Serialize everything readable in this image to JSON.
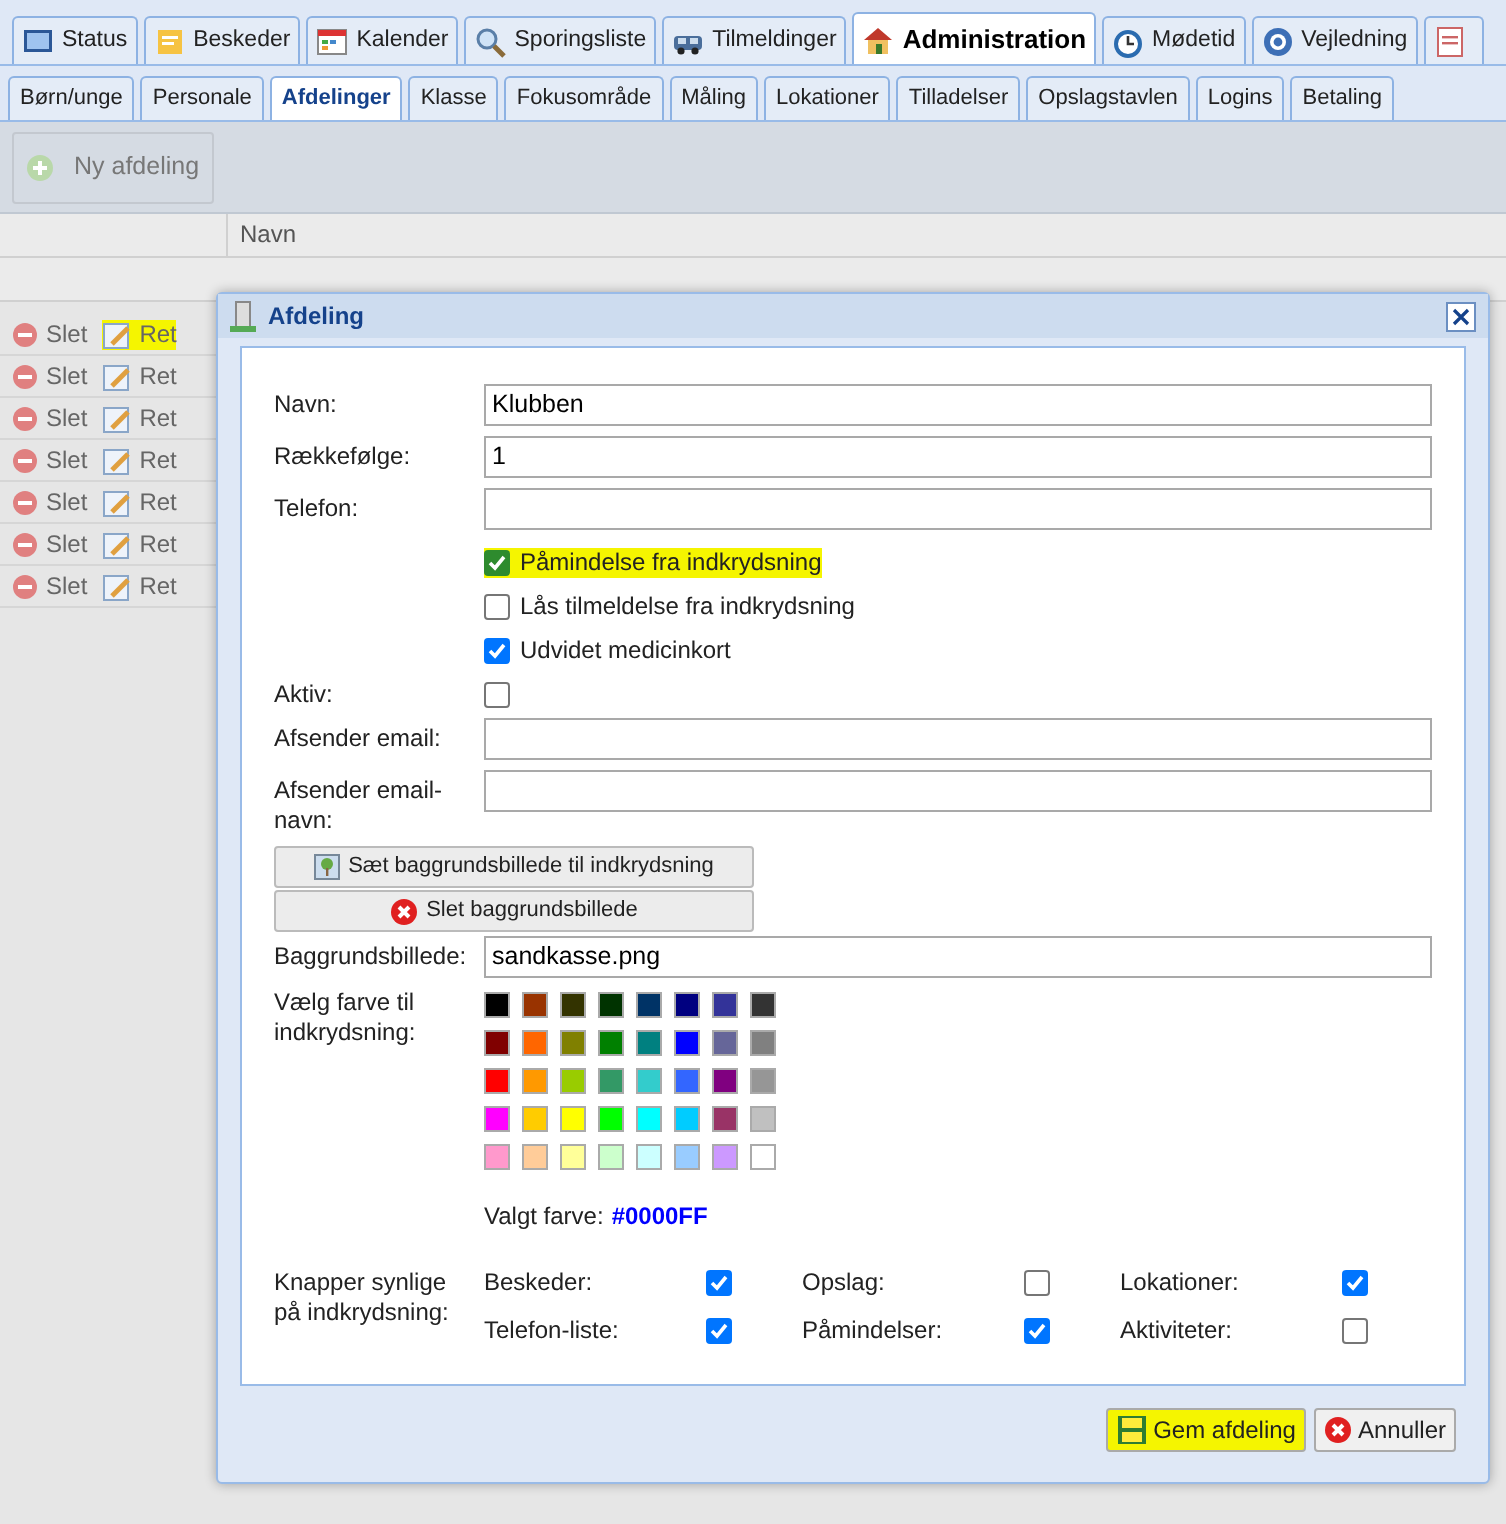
{
  "top_tabs": [
    {
      "label": "Status",
      "selected": false,
      "highlighted": false
    },
    {
      "label": "Beskeder",
      "selected": false,
      "highlighted": false
    },
    {
      "label": "Kalender",
      "selected": false,
      "highlighted": false
    },
    {
      "label": "Sporingsliste",
      "selected": false,
      "highlighted": false
    },
    {
      "label": "Tilmeldinger",
      "selected": false,
      "highlighted": false
    },
    {
      "label": "Administration",
      "selected": true,
      "highlighted": true
    },
    {
      "label": "Mødetid",
      "selected": false,
      "highlighted": false
    },
    {
      "label": "Vejledning",
      "selected": false,
      "highlighted": false
    }
  ],
  "sub_tabs": [
    {
      "label": "Børn/unge",
      "selected": false,
      "highlighted": false
    },
    {
      "label": "Personale",
      "selected": false,
      "highlighted": false
    },
    {
      "label": "Afdelinger",
      "selected": true,
      "highlighted": true
    },
    {
      "label": "Klasse",
      "selected": false,
      "highlighted": false
    },
    {
      "label": "Fokusområde",
      "selected": false,
      "highlighted": false
    },
    {
      "label": "Måling",
      "selected": false,
      "highlighted": false
    },
    {
      "label": "Lokationer",
      "selected": false,
      "highlighted": false
    },
    {
      "label": "Tilladelser",
      "selected": false,
      "highlighted": false
    },
    {
      "label": "Opslagstavlen",
      "selected": false,
      "highlighted": false
    },
    {
      "label": "Logins",
      "selected": false,
      "highlighted": false
    },
    {
      "label": "Betaling",
      "selected": false,
      "highlighted": false
    }
  ],
  "toolbar": {
    "new_button": "Ny afdeling"
  },
  "grid": {
    "column": "Navn",
    "rows": [
      {
        "delete": "Slet",
        "edit": "Ret",
        "highlighted": true
      },
      {
        "delete": "Slet",
        "edit": "Ret",
        "highlighted": false
      },
      {
        "delete": "Slet",
        "edit": "Ret",
        "highlighted": false
      },
      {
        "delete": "Slet",
        "edit": "Ret",
        "highlighted": false
      },
      {
        "delete": "Slet",
        "edit": "Ret",
        "highlighted": false
      },
      {
        "delete": "Slet",
        "edit": "Ret",
        "highlighted": false
      },
      {
        "delete": "Slet",
        "edit": "Ret",
        "highlighted": false
      }
    ]
  },
  "dialog": {
    "title": "Afdeling",
    "fields": [
      {
        "kind": "input",
        "label": "Navn:",
        "value": "Klubben"
      },
      {
        "kind": "input",
        "label": "Rækkefølge:",
        "value": "1"
      },
      {
        "kind": "input",
        "label": "Telefon:"
      },
      {
        "kind": "option",
        "label": "Påmindelse fra indkrydsning",
        "checked": true,
        "highlighted": true
      },
      {
        "kind": "option",
        "label": "Lås tilmeldelse fra indkrydsning",
        "checked": false,
        "highlighted": false
      },
      {
        "kind": "option",
        "label": "Udvidet medicinkort",
        "checked": true,
        "highlighted": false
      },
      {
        "kind": "checkbox",
        "label": "Aktiv:",
        "checked": false
      },
      {
        "kind": "input",
        "label": "Afsender email:"
      },
      {
        "kind": "input",
        "label": "Afsender email-navn:"
      }
    ],
    "image_buttons": [
      {
        "label": "Sæt baggrundsbillede til indkrydsning",
        "kind": "set"
      },
      {
        "label": "Slet baggrundsbillede",
        "kind": "delete"
      }
    ],
    "background": {
      "label": "Baggrundsbillede:",
      "value": "sandkasse.png"
    },
    "palette": {
      "label": "Vælg farve til indkrydsning:",
      "swatches": [
        {
          "color": "#000000"
        },
        {
          "color": "#993300"
        },
        {
          "color": "#333300"
        },
        {
          "color": "#003300"
        },
        {
          "color": "#003366"
        },
        {
          "color": "#000080"
        },
        {
          "color": "#333399"
        },
        {
          "color": "#333333"
        },
        {
          "color": "#800000"
        },
        {
          "color": "#ff6600"
        },
        {
          "color": "#808000"
        },
        {
          "color": "#008000"
        },
        {
          "color": "#008080"
        },
        {
          "color": "#0000ff"
        },
        {
          "color": "#666699"
        },
        {
          "color": "#808080"
        },
        {
          "color": "#ff0000"
        },
        {
          "color": "#ff9900"
        },
        {
          "color": "#99cc00"
        },
        {
          "color": "#339966"
        },
        {
          "color": "#33cccc"
        },
        {
          "color": "#3366ff"
        },
        {
          "color": "#800080"
        },
        {
          "color": "#969696"
        },
        {
          "color": "#ff00ff"
        },
        {
          "color": "#ffcc00"
        },
        {
          "color": "#ffff00"
        },
        {
          "color": "#00ff00"
        },
        {
          "color": "#00ffff"
        },
        {
          "color": "#00ccff"
        },
        {
          "color": "#993366"
        },
        {
          "color": "#c0c0c0"
        },
        {
          "color": "#ff99cc"
        },
        {
          "color": "#ffcc99"
        },
        {
          "color": "#ffff99"
        },
        {
          "color": "#ccffcc"
        },
        {
          "color": "#ccffff"
        },
        {
          "color": "#99ccff"
        },
        {
          "color": "#cc99ff"
        },
        {
          "color": "#ffffff"
        }
      ],
      "chosen_label": "Valgt farve:",
      "chosen_value": "#0000FF"
    },
    "visible_buttons": {
      "label": "Knapper synlige på indkrydsning:",
      "items": [
        {
          "label": "Beskeder:",
          "checked": true
        },
        {
          "label": "Opslag:",
          "checked": false
        },
        {
          "label": "Lokationer:",
          "checked": true
        },
        {
          "label": "Telefon-liste:",
          "checked": true
        },
        {
          "label": "Påmindelser:",
          "checked": true
        },
        {
          "label": "Aktiviteter:",
          "checked": false
        }
      ]
    },
    "actions": [
      {
        "label": "Gem afdeling",
        "kind": "save",
        "highlighted": true
      },
      {
        "label": "Annuller",
        "kind": "cancel",
        "highlighted": false
      }
    ]
  }
}
